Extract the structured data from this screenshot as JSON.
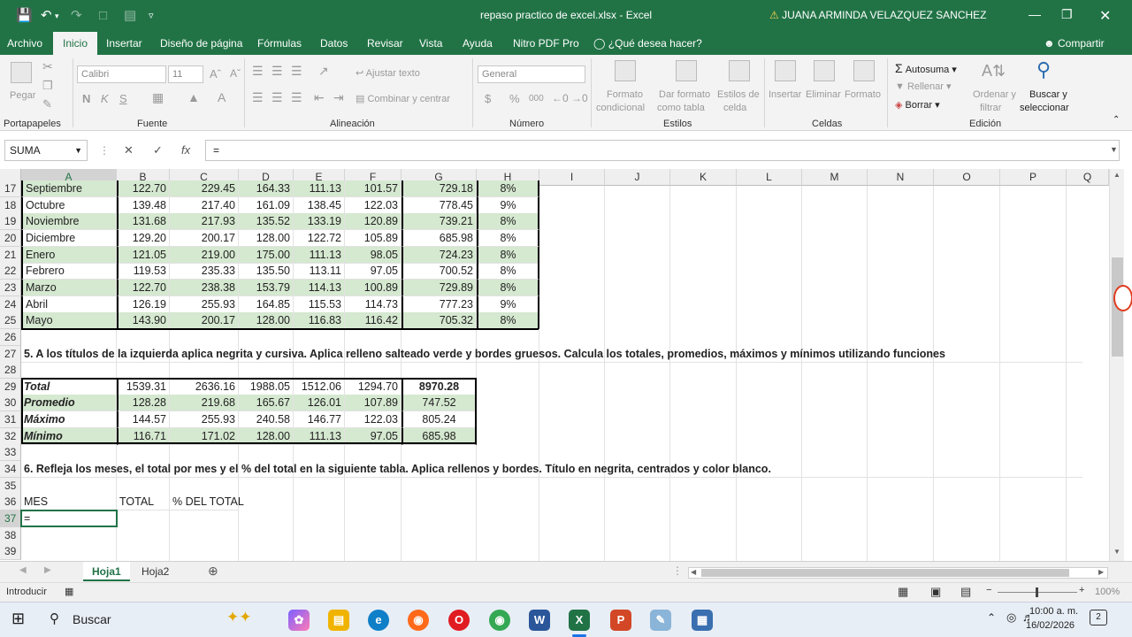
{
  "window": {
    "title": "repaso practico de excel.xlsx  -  Excel",
    "user": "JUANA ARMINDA VELAZQUEZ SANCHEZ",
    "warning_icon": "warning-icon"
  },
  "menu": {
    "tabs": [
      "Archivo",
      "Inicio",
      "Insertar",
      "Diseño de página",
      "Fórmulas",
      "Datos",
      "Revisar",
      "Vista",
      "Ayuda",
      "Nitro PDF Pro",
      "¿Qué desea hacer?"
    ],
    "share": "Compartir"
  },
  "ribbon": {
    "paste": "Pegar",
    "font_name": "Calibri",
    "font_size": "11",
    "bold": "N",
    "italic": "K",
    "underline": "S",
    "wrap_text": "Ajustar texto",
    "merge": "Combinar y centrar",
    "number_format": "General",
    "currency": "$",
    "percent": "%",
    "thousands": "000",
    "cond_format_1": "Formato",
    "cond_format_2": "condicional",
    "table_format_1": "Dar formato",
    "table_format_2": "como tabla",
    "cell_styles_1": "Estilos de",
    "cell_styles_2": "celda",
    "insert": "Insertar",
    "delete": "Eliminar",
    "format": "Formato",
    "autosum": "Autosuma",
    "fill": "Rellenar",
    "clear": "Borrar",
    "sort_1": "Ordenar y",
    "sort_2": "filtrar",
    "find_1": "Buscar y",
    "find_2": "seleccionar",
    "groups": [
      "Portapapeles",
      "Fuente",
      "Alineación",
      "Número",
      "Estilos",
      "Celdas",
      "Edición"
    ]
  },
  "formula_bar": {
    "name_box": "SUMA",
    "cancel": "✕",
    "enter": "✓",
    "fx": "fx",
    "content": "="
  },
  "columns": [
    "A",
    "B",
    "C",
    "D",
    "E",
    "F",
    "G",
    "H",
    "I",
    "J",
    "K",
    "L",
    "M",
    "N",
    "O",
    "P",
    "Q"
  ],
  "rows": [
    {
      "n": "17",
      "cells": [
        "Septiembre",
        "122.70",
        "229.45",
        "164.33",
        "111.13",
        "101.57",
        "729.18",
        "8%"
      ],
      "green": true
    },
    {
      "n": "18",
      "cells": [
        "Octubre",
        "139.48",
        "217.40",
        "161.09",
        "138.45",
        "122.03",
        "778.45",
        "9%"
      ],
      "green": false
    },
    {
      "n": "19",
      "cells": [
        "Noviembre",
        "131.68",
        "217.93",
        "135.52",
        "133.19",
        "120.89",
        "739.21",
        "8%"
      ],
      "green": true
    },
    {
      "n": "20",
      "cells": [
        "Diciembre",
        "129.20",
        "200.17",
        "128.00",
        "122.72",
        "105.89",
        "685.98",
        "8%"
      ],
      "green": false
    },
    {
      "n": "21",
      "cells": [
        "Enero",
        "121.05",
        "219.00",
        "175.00",
        "111.13",
        "98.05",
        "724.23",
        "8%"
      ],
      "green": true
    },
    {
      "n": "22",
      "cells": [
        "Febrero",
        "119.53",
        "235.33",
        "135.50",
        "113.11",
        "97.05",
        "700.52",
        "8%"
      ],
      "green": false
    },
    {
      "n": "23",
      "cells": [
        "Marzo",
        "122.70",
        "238.38",
        "153.79",
        "114.13",
        "100.89",
        "729.89",
        "8%"
      ],
      "green": true
    },
    {
      "n": "24",
      "cells": [
        "Abril",
        "126.19",
        "255.93",
        "164.85",
        "115.53",
        "114.73",
        "777.23",
        "9%"
      ],
      "green": false
    },
    {
      "n": "25",
      "cells": [
        "Mayo",
        "143.90",
        "200.17",
        "128.00",
        "116.83",
        "116.42",
        "705.32",
        "8%"
      ],
      "green": true
    }
  ],
  "row26": "26",
  "row27": {
    "n": "27",
    "text": "5. A los títulos de la izquierda aplica negrita y cursiva. Aplica relleno salteado verde y bordes gruesos. Calcula los totales, promedios, máximos y mínimos utilizando funciones"
  },
  "row28": "28",
  "stats": [
    {
      "n": "29",
      "cells": [
        "Total",
        "1539.31",
        "2636.16",
        "1988.05",
        "1512.06",
        "1294.70",
        "8970.28"
      ],
      "green": false
    },
    {
      "n": "30",
      "cells": [
        "Promedio",
        "128.28",
        "219.68",
        "165.67",
        "126.01",
        "107.89",
        "747.52"
      ],
      "green": true
    },
    {
      "n": "31",
      "cells": [
        "Máximo",
        "144.57",
        "255.93",
        "240.58",
        "146.77",
        "122.03",
        "805.24"
      ],
      "green": false
    },
    {
      "n": "32",
      "cells": [
        "Mínimo",
        "116.71",
        "171.02",
        "128.00",
        "111.13",
        "97.05",
        "685.98"
      ],
      "green": true
    }
  ],
  "row33": "33",
  "row34": {
    "n": "34",
    "text": "6. Refleja los meses, el total por mes y el % del total en la siguiente tabla. Aplica rellenos y bordes. Título en negrita, centrados y color blanco."
  },
  "row35": "35",
  "row36": {
    "n": "36",
    "mes": "MES",
    "total": "TOTAL",
    "pct": "% DEL TOTAL"
  },
  "row37": {
    "n": "37",
    "value": "="
  },
  "row38": "38",
  "row39": "39",
  "sheets": [
    "Hoja1",
    "Hoja2"
  ],
  "status": {
    "mode": "Introducir",
    "zoom": "100%"
  },
  "taskbar": {
    "search": "Buscar",
    "time": "10:00 a. m.",
    "date": "16/02/2026",
    "notifications": "2"
  }
}
